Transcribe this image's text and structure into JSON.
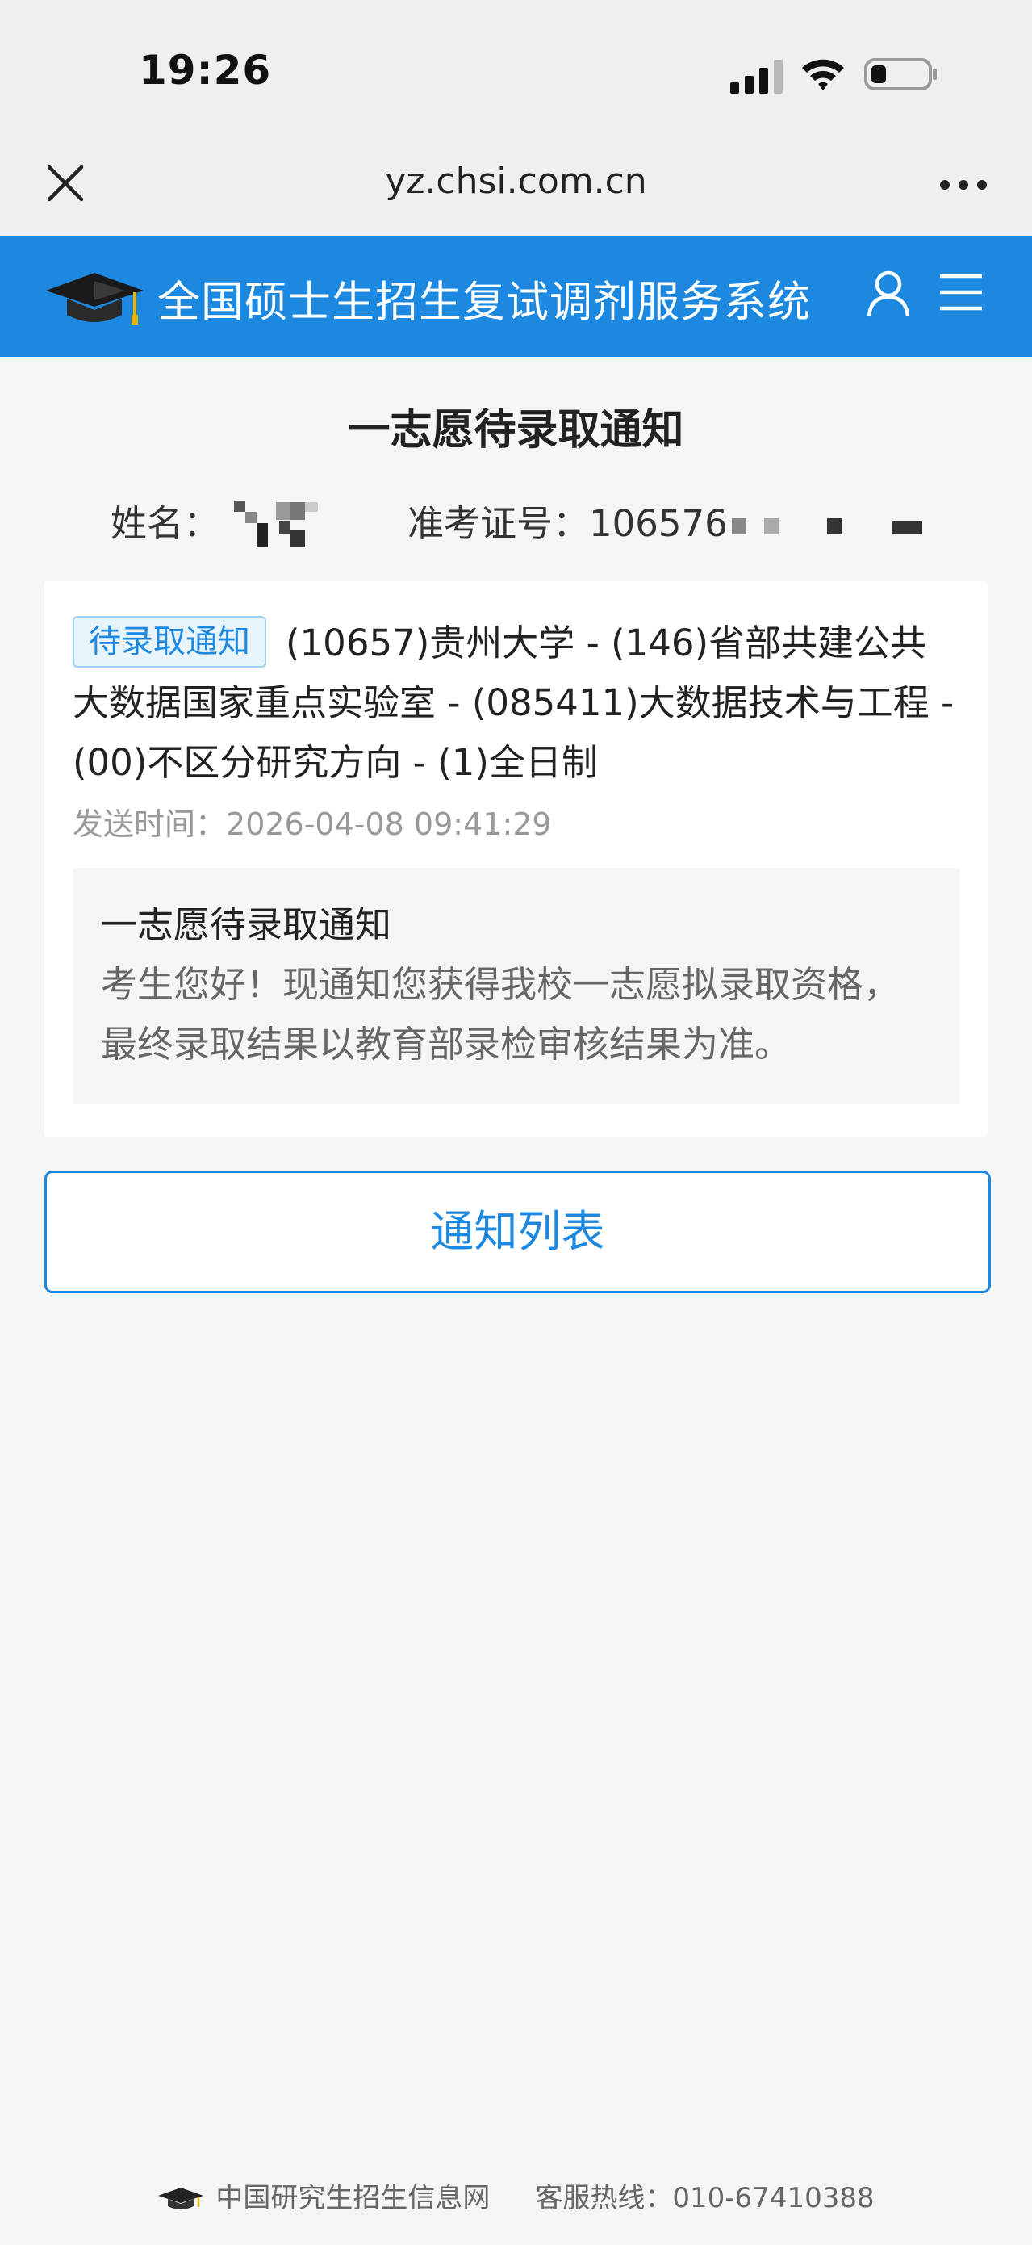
{
  "status_bar": {
    "time": "19:26"
  },
  "browser": {
    "url": "yz.chsi.com.cn"
  },
  "header": {
    "title": "全国硕士生招生复试调剂服务系统"
  },
  "page": {
    "title": "一志愿待录取通知",
    "name_label": "姓名：",
    "exam_label": "准考证号：",
    "exam_number_prefix": "106576"
  },
  "notice": {
    "badge": "待录取通知",
    "detail": "(10657)贵州大学 - (146)省部共建公共大数据国家重点实验室 - (085411)大数据技术与工程 - (00)不区分研究方向 - (1)全日制",
    "sent_label": "发送时间：",
    "sent_time": "2026-04-08 09:41:29",
    "message_title": "一志愿待录取通知",
    "message_text": "考生您好！现通知您获得我校一志愿拟录取资格，最终录取结果以教育部录检审核结果为准。"
  },
  "buttons": {
    "list": "通知列表"
  },
  "footer": {
    "site_name": "中国研究生招生信息网",
    "hotline": "客服热线：010-67410388"
  },
  "colors": {
    "primary": "#1d88e0",
    "background": "#f4f5f7",
    "badge_bg": "#e8f4fc"
  }
}
